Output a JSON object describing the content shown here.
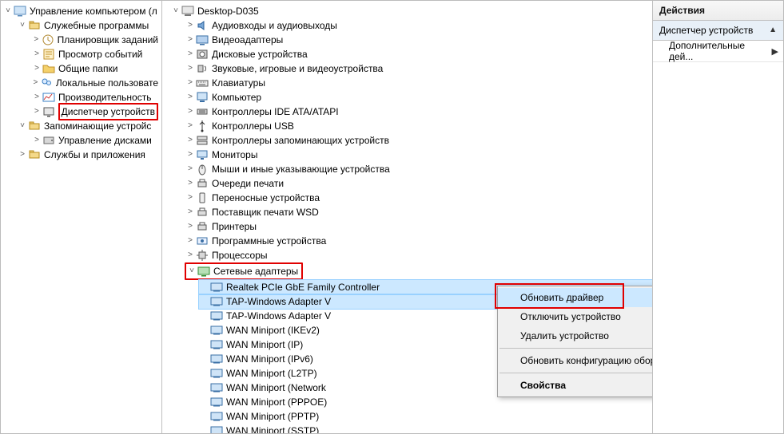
{
  "left": {
    "root": {
      "label": "Управление компьютером (л"
    },
    "groups": [
      {
        "label": "Служебные программы",
        "children": [
          {
            "label": "Планировщик заданий",
            "icon": "clock"
          },
          {
            "label": "Просмотр событий",
            "icon": "event"
          },
          {
            "label": "Общие папки",
            "icon": "folder-shared"
          },
          {
            "label": "Локальные пользовате",
            "icon": "users"
          },
          {
            "label": "Производительность",
            "icon": "perf"
          },
          {
            "label": "Диспетчер устройств",
            "icon": "device-mgr",
            "highlight": true
          }
        ]
      },
      {
        "label": "Запоминающие устройс",
        "children": [
          {
            "label": "Управление дисками",
            "icon": "disk-mgmt"
          }
        ]
      },
      {
        "label": "Службы и приложения",
        "children": []
      }
    ]
  },
  "center": {
    "root": {
      "label": "Desktop-D035"
    },
    "categories": [
      {
        "label": "Аудиовходы и аудиовыходы",
        "icon": "audio"
      },
      {
        "label": "Видеоадаптеры",
        "icon": "display"
      },
      {
        "label": "Дисковые устройства",
        "icon": "disk"
      },
      {
        "label": "Звуковые, игровые и видеоустройства",
        "icon": "sound"
      },
      {
        "label": "Клавиатуры",
        "icon": "keyboard"
      },
      {
        "label": "Компьютер",
        "icon": "computer"
      },
      {
        "label": "Контроллеры IDE ATA/ATAPI",
        "icon": "ide"
      },
      {
        "label": "Контроллеры USB",
        "icon": "usb"
      },
      {
        "label": "Контроллеры запоминающих устройств",
        "icon": "storage-ctl"
      },
      {
        "label": "Мониторы",
        "icon": "monitor"
      },
      {
        "label": "Мыши и иные указывающие устройства",
        "icon": "mouse"
      },
      {
        "label": "Очереди печати",
        "icon": "print-queue"
      },
      {
        "label": "Переносные устройства",
        "icon": "portable"
      },
      {
        "label": "Поставщик печати WSD",
        "icon": "wsd"
      },
      {
        "label": "Принтеры",
        "icon": "printer"
      },
      {
        "label": "Программные устройства",
        "icon": "software"
      },
      {
        "label": "Процессоры",
        "icon": "cpu"
      }
    ],
    "network": {
      "label": "Сетевые адаптеры",
      "icon": "net",
      "highlight": true,
      "devices": [
        {
          "label": "Realtek PCIe GbE Family Controller",
          "selected": true
        },
        {
          "label": "TAP-Windows Adapter V",
          "selected": true
        },
        {
          "label": "TAP-Windows Adapter V"
        },
        {
          "label": "WAN Miniport (IKEv2)"
        },
        {
          "label": "WAN Miniport (IP)"
        },
        {
          "label": "WAN Miniport (IPv6)"
        },
        {
          "label": "WAN Miniport (L2TP)"
        },
        {
          "label": "WAN Miniport (Network"
        },
        {
          "label": "WAN Miniport (PPPOE)"
        },
        {
          "label": "WAN Miniport (PPTP)"
        },
        {
          "label": "WAN Miniport (SSTP)"
        }
      ]
    }
  },
  "context_menu": {
    "items": [
      {
        "label": "Обновить драйвер",
        "hot": true
      },
      {
        "label": "Отключить устройство"
      },
      {
        "label": "Удалить устройство"
      },
      {
        "sep": true
      },
      {
        "label": "Обновить конфигурацию оборудования"
      },
      {
        "sep": true
      },
      {
        "label": "Свойства",
        "bold": true
      }
    ]
  },
  "right": {
    "header": "Действия",
    "section": "Диспетчер устройств",
    "more": "Дополнительные дей..."
  },
  "icons": {
    "tw_open": "▽",
    "tw_closed": "▷",
    "root": "🖳"
  }
}
